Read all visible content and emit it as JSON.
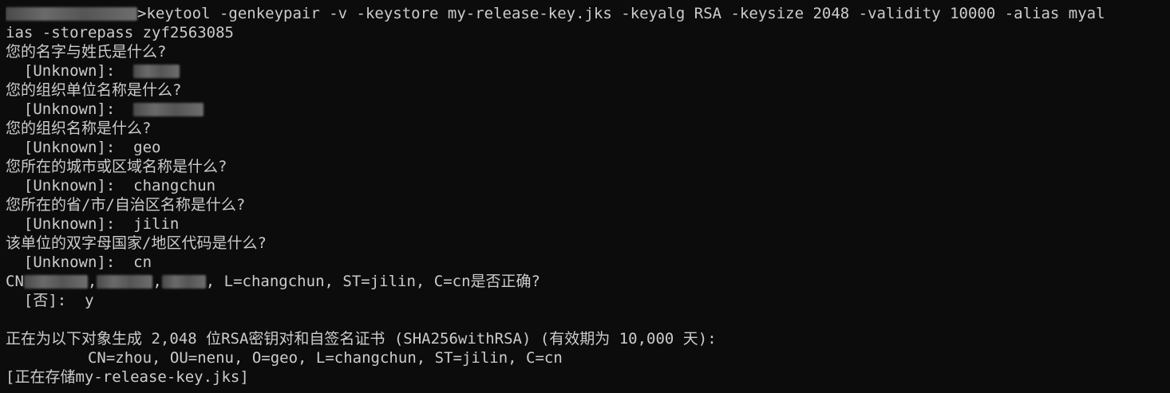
{
  "terminal": {
    "command_line_1": ">keytool -genkeypair -v -keystore my-release-key.jks -keyalg RSA -keysize 2048 -validity 10000 -alias myal",
    "command_line_2": "ias -storepass zyf2563085",
    "q_name": "您的名字与姓氏是什么?",
    "q_org_unit": "您的组织单位名称是什么?",
    "q_org": "您的组织名称是什么?",
    "q_city": "您所在的城市或区域名称是什么?",
    "q_state": "您所在的省/市/自治区名称是什么?",
    "q_country": "该单位的双字母国家/地区代码是什么?",
    "default_label": "  [Unknown]:  ",
    "answer_org": "geo",
    "answer_city": "changchun",
    "answer_state": "jilin",
    "answer_country": "cn",
    "confirm_prefix": "CN",
    "confirm_sep1": ",",
    "confirm_sep2": ",",
    "confirm_suffix": ", L=changchun, ST=jilin, C=cn是否正确?",
    "confirm_prompt": "  [否]:  ",
    "confirm_answer": "y",
    "gen_line": "正在为以下对象生成 2,048 位RSA密钥对和自签名证书 (SHA256withRSA) (有效期为 10,000 天):",
    "dn_line": "         CN=zhou, OU=nenu, O=geo, L=changchun, ST=jilin, C=cn",
    "store_line": "[正在存储my-release-key.jks]"
  }
}
